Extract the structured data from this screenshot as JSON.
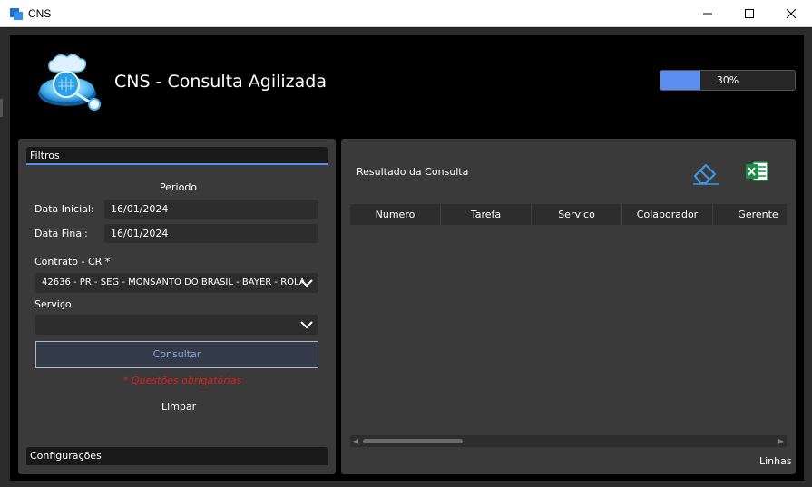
{
  "window": {
    "title": "CNS"
  },
  "header": {
    "app_title": "CNS - Consulta Agilizada",
    "progress_value": 0.3,
    "progress_text": "30%"
  },
  "filters": {
    "section_title": "Filtros",
    "period_label": "Periodo",
    "start_date_label": "Data Inicial:",
    "start_date_value": "16/01/2024",
    "end_date_label": "Data Final:",
    "end_date_value": "16/01/2024",
    "contract_label": "Contrato - CR *",
    "contract_value": "42636 - PR - SEG - MONSANTO DO BRASIL - BAYER - ROLA",
    "service_label": "Serviço",
    "service_value": "",
    "consult_button": "Consultar",
    "required_note": "*  Questões obrigatórias",
    "clear_button": "Limpar",
    "config_section_title": "Configurações"
  },
  "results": {
    "title": "Resultado da Consulta",
    "columns": [
      "Numero",
      "Tarefa",
      "Servico",
      "Colaborador",
      "Gerente"
    ],
    "rows": [],
    "footer_label": "Linhas"
  },
  "icons": {
    "eraser": "eraser-icon",
    "excel": "excel-icon"
  },
  "colors": {
    "accent": "#5b8def",
    "required": "#e21b1b",
    "excel_green": "#1d8a45"
  }
}
